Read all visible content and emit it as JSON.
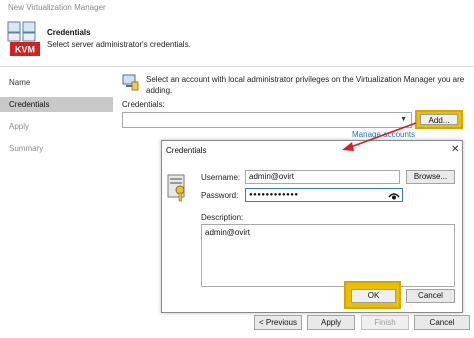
{
  "window": {
    "title": "New Virtualization Manager"
  },
  "header": {
    "title": "Credentials",
    "subtitle": "Select server administrator's credentials.",
    "badge": "KVM"
  },
  "nav": {
    "items": [
      {
        "label": "Name",
        "state": "normal"
      },
      {
        "label": "Credentials",
        "state": "active"
      },
      {
        "label": "Apply",
        "state": "disabled"
      },
      {
        "label": "Summary",
        "state": "disabled"
      }
    ]
  },
  "main": {
    "info_line1": "Select an account with local administrator privileges on the Virtualization Manager you are",
    "info_line2": "adding.",
    "credentials_label": "Credentials:",
    "credentials_value": "",
    "add_label": "Add...",
    "manage_link": "Manage accounts"
  },
  "dialog": {
    "title": "Credentials",
    "close_glyph": "✕",
    "username_label": "Username:",
    "username_value": "admin@ovirt",
    "browse_label": "Browse...",
    "password_label": "Password:",
    "password_value": "●●●●●●●●●●●●",
    "description_label": "Description:",
    "description_value": "admin@ovirt",
    "ok_label": "OK",
    "cancel_label": "Cancel"
  },
  "footer": {
    "previous_label": "< Previous",
    "apply_label": "Apply",
    "finish_label": "Finish",
    "cancel_label": "Cancel"
  },
  "colors": {
    "highlight": "#e7c100",
    "link": "#1a73c6",
    "arrow": "#d42020",
    "active_nav": "#c8c8c8"
  }
}
